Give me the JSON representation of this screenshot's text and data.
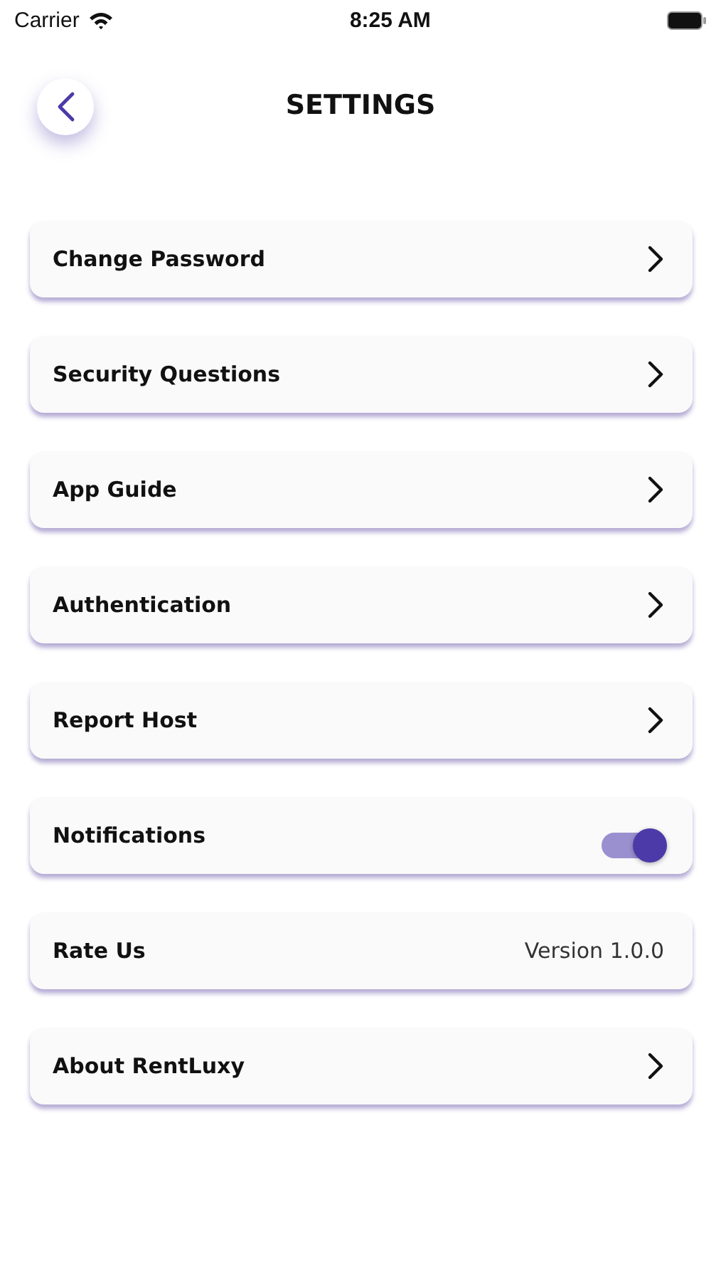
{
  "status_bar": {
    "carrier": "Carrier",
    "time": "8:25 AM"
  },
  "header": {
    "title": "SETTINGS"
  },
  "items": [
    {
      "kind": "link",
      "label": "Change Password"
    },
    {
      "kind": "link",
      "label": "Security Questions"
    },
    {
      "kind": "link",
      "label": "App Guide"
    },
    {
      "kind": "link",
      "label": "Authentication"
    },
    {
      "kind": "link",
      "label": "Report Host"
    },
    {
      "kind": "toggle",
      "label": "Notifications",
      "on": true
    },
    {
      "kind": "info",
      "label": "Rate Us",
      "detail": "Version 1.0.0"
    },
    {
      "kind": "link",
      "label": "About RentLuxy"
    }
  ]
}
